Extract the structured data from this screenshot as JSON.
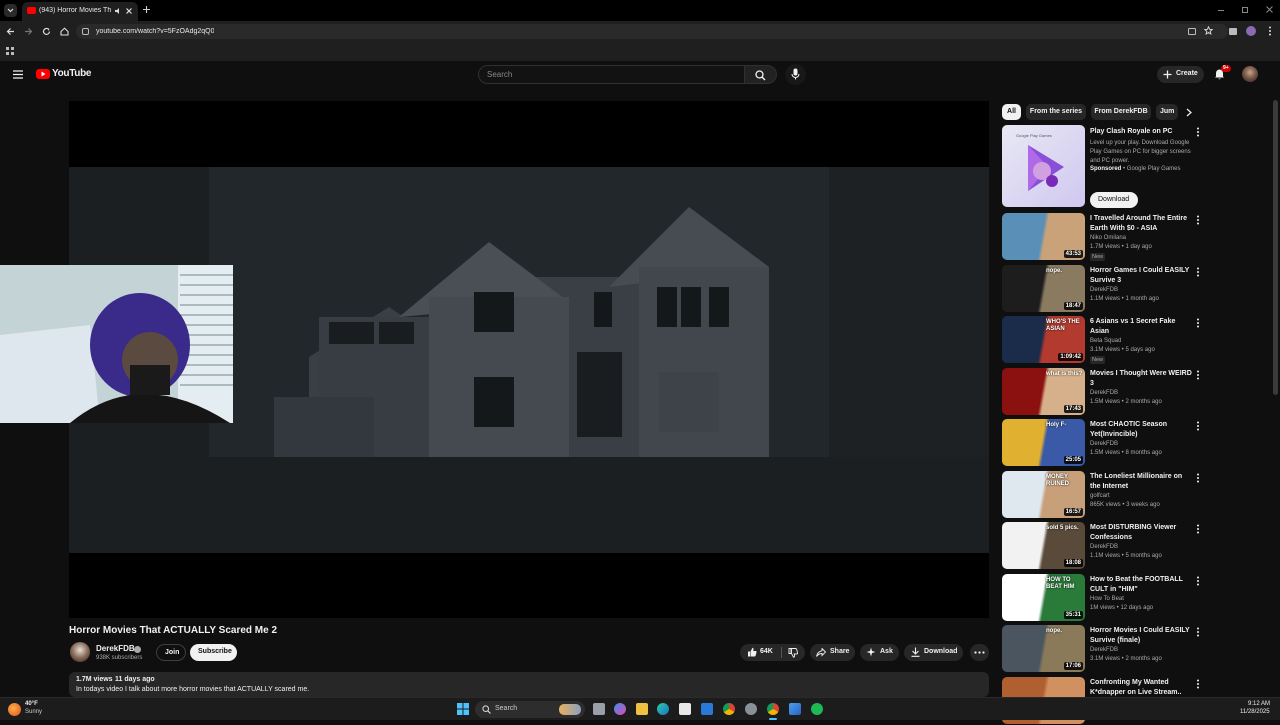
{
  "browser": {
    "tab_title": "(943) Horror Movies That A",
    "url": "youtube.com/watch?v=5FzOAdg2qQ0"
  },
  "header": {
    "logo_text": "YouTube",
    "search_placeholder": "Search",
    "create_label": "Create",
    "notification_count": "9+"
  },
  "video": {
    "title": "Horror Movies That ACTUALLY Scared Me 2",
    "channel": "DerekFDB",
    "subscribers": "938K subscribers",
    "join_label": "Join",
    "subscribe_label": "Subscribe",
    "likes": "64K",
    "share_label": "Share",
    "ask_label": "Ask",
    "download_label": "Download",
    "views": "1.7M views",
    "age": "11 days ago",
    "description": "In todays video I talk about more horror movies that ACTUALLY scared me."
  },
  "chips": [
    "All",
    "From the series",
    "From DerekFDB",
    "Jum"
  ],
  "ad": {
    "title": "Play Clash Royale on PC",
    "desc": "Level up your play. Download Google Play Games on PC for bigger screens and PC power.",
    "sponsored": "Sponsored",
    "advertiser": "Google Play Games",
    "thumb_label": "Google Play Games",
    "button": "Download"
  },
  "recommendations": [
    {
      "title": "I Travelled Around The Entire Earth With $0 - ASIA",
      "channel": "Niko Omilana",
      "meta": "1.7M views • 1 day ago",
      "badge": "New",
      "duration": "43:53",
      "thumb_text": "",
      "colors": [
        "#5a8fb8",
        "#c9a27a"
      ]
    },
    {
      "title": "Horror Games I Could EASILY Survive 3",
      "channel": "DerekFDB",
      "meta": "1.1M views • 1 month ago",
      "badge": "",
      "duration": "18:47",
      "thumb_text": "nope.",
      "colors": [
        "#1d1d1d",
        "#8a7a60"
      ]
    },
    {
      "title": "6 Asians vs 1 Secret Fake Asian",
      "channel": "Beta Squad",
      "meta": "3.1M views • 5 days ago",
      "badge": "New",
      "duration": "1:09:42",
      "thumb_text": "WHO'S THE ASIAN",
      "colors": [
        "#1b2b4a",
        "#b33a2e"
      ]
    },
    {
      "title": "Movies I Thought Were WEIRD 3",
      "channel": "DerekFDB",
      "meta": "1.5M views • 2 months ago",
      "badge": "",
      "duration": "17:43",
      "thumb_text": "what is this?",
      "colors": [
        "#8b1010",
        "#d6b08a"
      ]
    },
    {
      "title": "Most CHAOTIC Season Yet(Invincible)",
      "channel": "DerekFDB",
      "meta": "1.5M views • 8 months ago",
      "badge": "",
      "duration": "25:05",
      "thumb_text": "Holy F-",
      "colors": [
        "#e0b030",
        "#3a5aa8"
      ]
    },
    {
      "title": "The Loneliest Millionaire on the Internet",
      "channel": "golfcart",
      "meta": "865K views • 3 weeks ago",
      "badge": "",
      "duration": "16:57",
      "thumb_text": "MONEY RUINED",
      "colors": [
        "#dfe7ef",
        "#c7a07a"
      ]
    },
    {
      "title": "Most DISTURBING Viewer Confessions",
      "channel": "DerekFDB",
      "meta": "1.1M views • 5 months ago",
      "badge": "",
      "duration": "18:08",
      "thumb_text": "sold 5 pics.",
      "colors": [
        "#f2f2f2",
        "#5a4a3a"
      ]
    },
    {
      "title": "How to Beat the FOOTBALL CULT in \"HIM\"",
      "channel": "How To Beat",
      "meta": "1M views • 12 days ago",
      "badge": "",
      "duration": "35:31",
      "thumb_text": "HOW TO BEAT HIM",
      "colors": [
        "#ffffff",
        "#2a7a3a"
      ]
    },
    {
      "title": "Horror Movies I Could EASILY Survive (finale)",
      "channel": "DerekFDB",
      "meta": "3.1M views • 2 months ago",
      "badge": "",
      "duration": "17:06",
      "thumb_text": "nope.",
      "colors": [
        "#4a5560",
        "#8a7a5a"
      ]
    },
    {
      "title": "Confronting My Wanted K*dnapper on Live Stream..",
      "channel": "",
      "meta": "",
      "badge": "",
      "duration": "",
      "thumb_text": "",
      "colors": [
        "#b06030",
        "#d09060"
      ]
    }
  ],
  "taskbar": {
    "weather_temp": "40°F",
    "weather_desc": "Sunny",
    "search_label": "Search",
    "time": "9:12 AM",
    "date": "11/28/2025"
  }
}
